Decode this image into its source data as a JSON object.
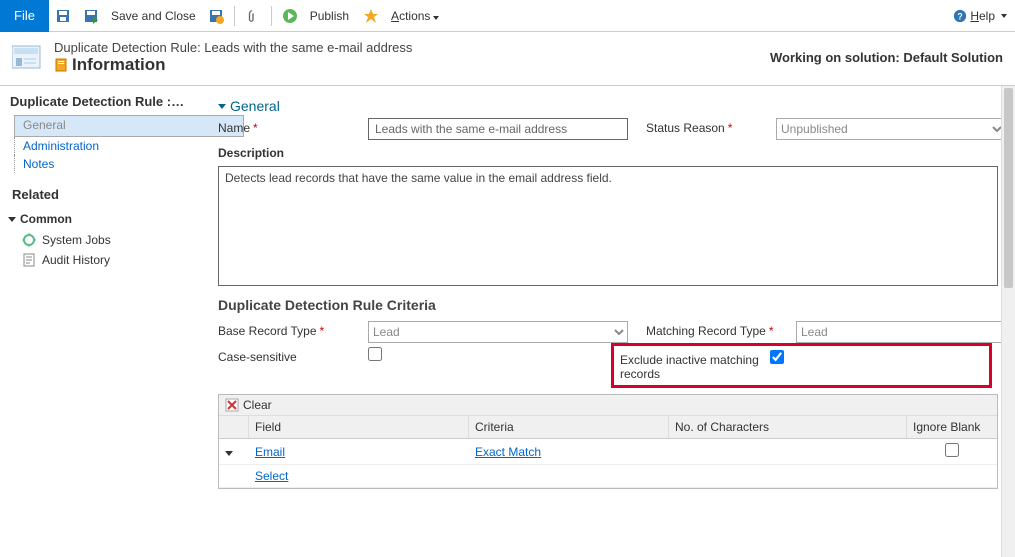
{
  "toolbar": {
    "file": "File",
    "save_close": "Save and Close",
    "publish": "Publish",
    "actions": "Actions",
    "help": "Help"
  },
  "header": {
    "title_line": "Duplicate Detection Rule: Leads with the same e-mail address",
    "subtitle": "Information",
    "working_on": "Working on solution: Default Solution"
  },
  "sidebar": {
    "title": "Duplicate Detection Rule :…",
    "items": [
      "General",
      "Administration",
      "Notes"
    ],
    "related": "Related",
    "common": "Common",
    "common_items": [
      "System Jobs",
      "Audit History"
    ]
  },
  "main": {
    "general": "General",
    "name_label": "Name",
    "name_value": "Leads with the same e-mail address",
    "status_label": "Status Reason",
    "status_value": "Unpublished",
    "desc_label": "Description",
    "desc_value": "Detects lead records that have the same value in the email address field.",
    "criteria_h": "Duplicate Detection Rule Criteria",
    "base_label": "Base Record Type",
    "base_value": "Lead",
    "matching_label": "Matching Record Type",
    "matching_value": "Lead",
    "case_label": "Case-sensitive",
    "exclude_label": "Exclude inactive matching records",
    "clear": "Clear",
    "cols": {
      "field": "Field",
      "criteria": "Criteria",
      "chars": "No. of Characters",
      "ignore": "Ignore Blank"
    },
    "rows": [
      {
        "field": "Email",
        "criteria": "Exact Match"
      },
      {
        "field": "Select",
        "criteria": ""
      }
    ]
  }
}
